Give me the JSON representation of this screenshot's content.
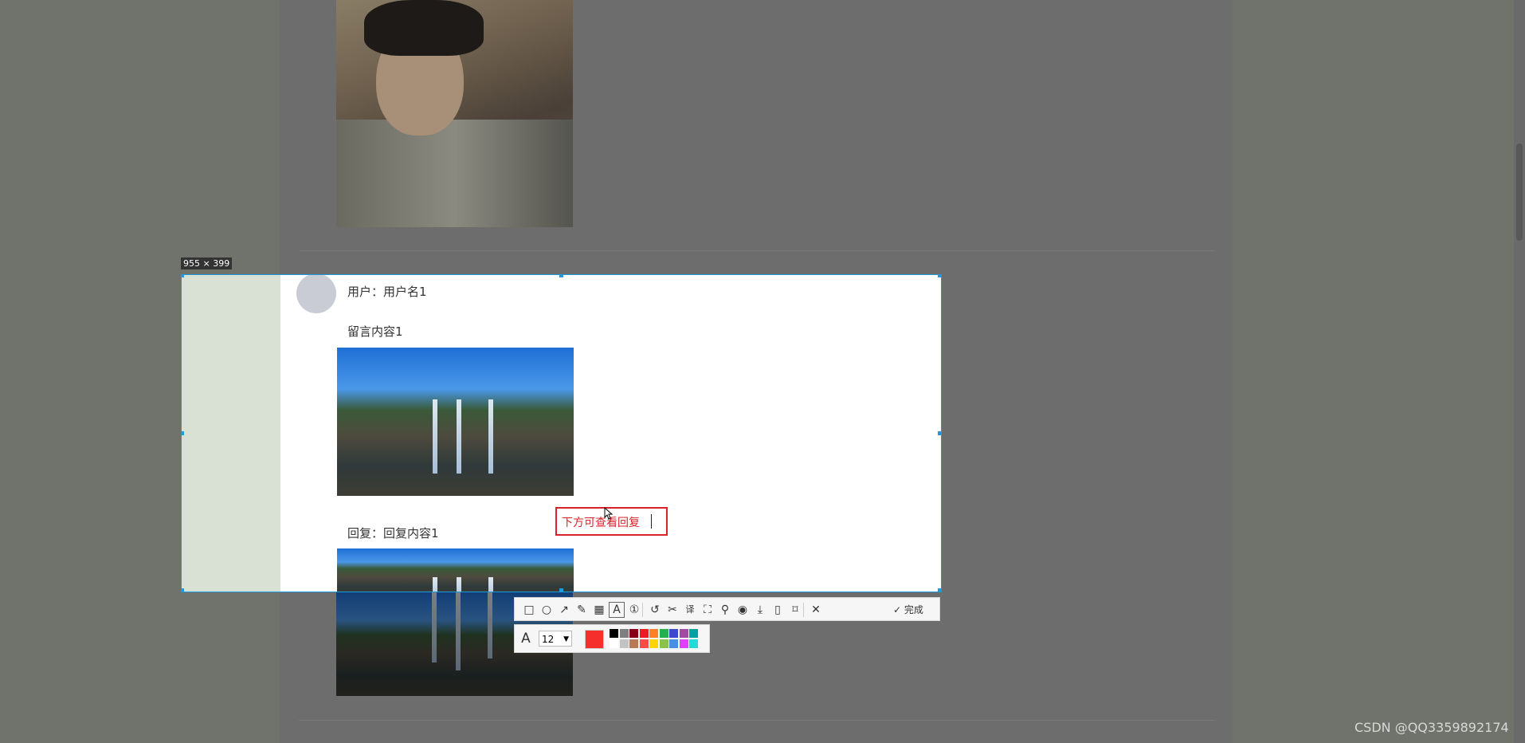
{
  "selection": {
    "size_label": "955 × 399"
  },
  "comment": {
    "user_label": "用户：用户名1",
    "content": "留言内容1",
    "reply_label": "回复：回复内容1"
  },
  "annotation": {
    "text": "下方可查看回复"
  },
  "toolbar": {
    "tools": [
      {
        "name": "rectangle-icon",
        "glyph": "□"
      },
      {
        "name": "ellipse-icon",
        "glyph": "○"
      },
      {
        "name": "arrow-icon",
        "glyph": "↗"
      },
      {
        "name": "pencil-icon",
        "glyph": "✎"
      },
      {
        "name": "mosaic-icon",
        "glyph": "▦"
      },
      {
        "name": "text-icon",
        "glyph": "A"
      },
      {
        "name": "number-icon",
        "glyph": "①"
      },
      {
        "name": "undo-icon",
        "glyph": "↺"
      },
      {
        "name": "ocr-icon",
        "glyph": "✂"
      },
      {
        "name": "translate-icon",
        "glyph": "译"
      },
      {
        "name": "screen-record-icon",
        "glyph": "⛶"
      },
      {
        "name": "pin-icon",
        "glyph": "⚲"
      },
      {
        "name": "record-icon",
        "glyph": "◉"
      },
      {
        "name": "download-icon",
        "glyph": "⤓"
      },
      {
        "name": "phone-icon",
        "glyph": "▯"
      },
      {
        "name": "bookmark-icon",
        "glyph": "⌑"
      },
      {
        "name": "close-icon",
        "glyph": "✕"
      }
    ],
    "done_label": "完成"
  },
  "text_props": {
    "font_icon": "A",
    "font_size": "12",
    "current_color": "#f5302c",
    "palette_top": [
      "#000000",
      "#7f7f7f",
      "#880015",
      "#ed1c24",
      "#ff7f27",
      "#22b14c",
      "#3f48cc",
      "#a349a4",
      "#00a2a2"
    ],
    "palette_bottom": [
      "#ffffff",
      "#c3c3c3",
      "#b97a57",
      "#ff4a4a",
      "#ffd400",
      "#8bc34a",
      "#4a90e2",
      "#e040fb",
      "#26d9d9"
    ]
  },
  "watermark": "CSDN @QQ3359892174"
}
